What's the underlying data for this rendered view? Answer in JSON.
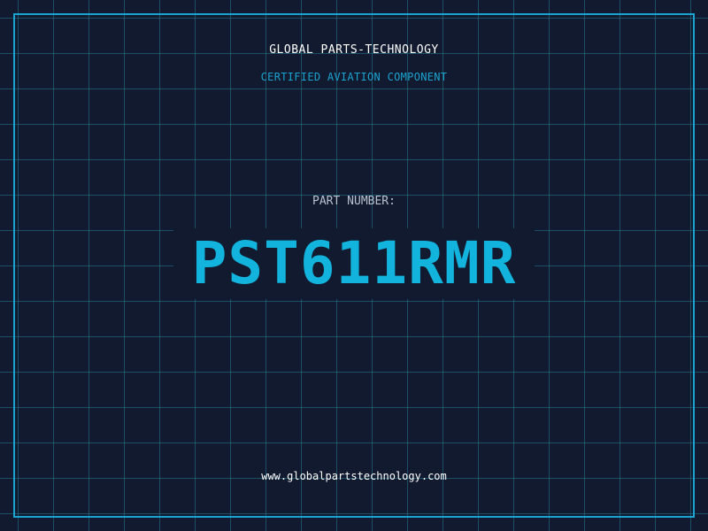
{
  "header": {
    "company": "GLOBAL PARTS-TECHNOLOGY",
    "subtitle": "CERTIFIED AVIATION COMPONENT"
  },
  "part": {
    "label": "PART NUMBER:",
    "number": "PST611RMR"
  },
  "footer": {
    "website": "www.globalpartstechnology.com"
  },
  "colors": {
    "background": "#111a2e",
    "accent": "#1aa3d0",
    "part_number": "#12b4de",
    "text": "#ffffff"
  }
}
